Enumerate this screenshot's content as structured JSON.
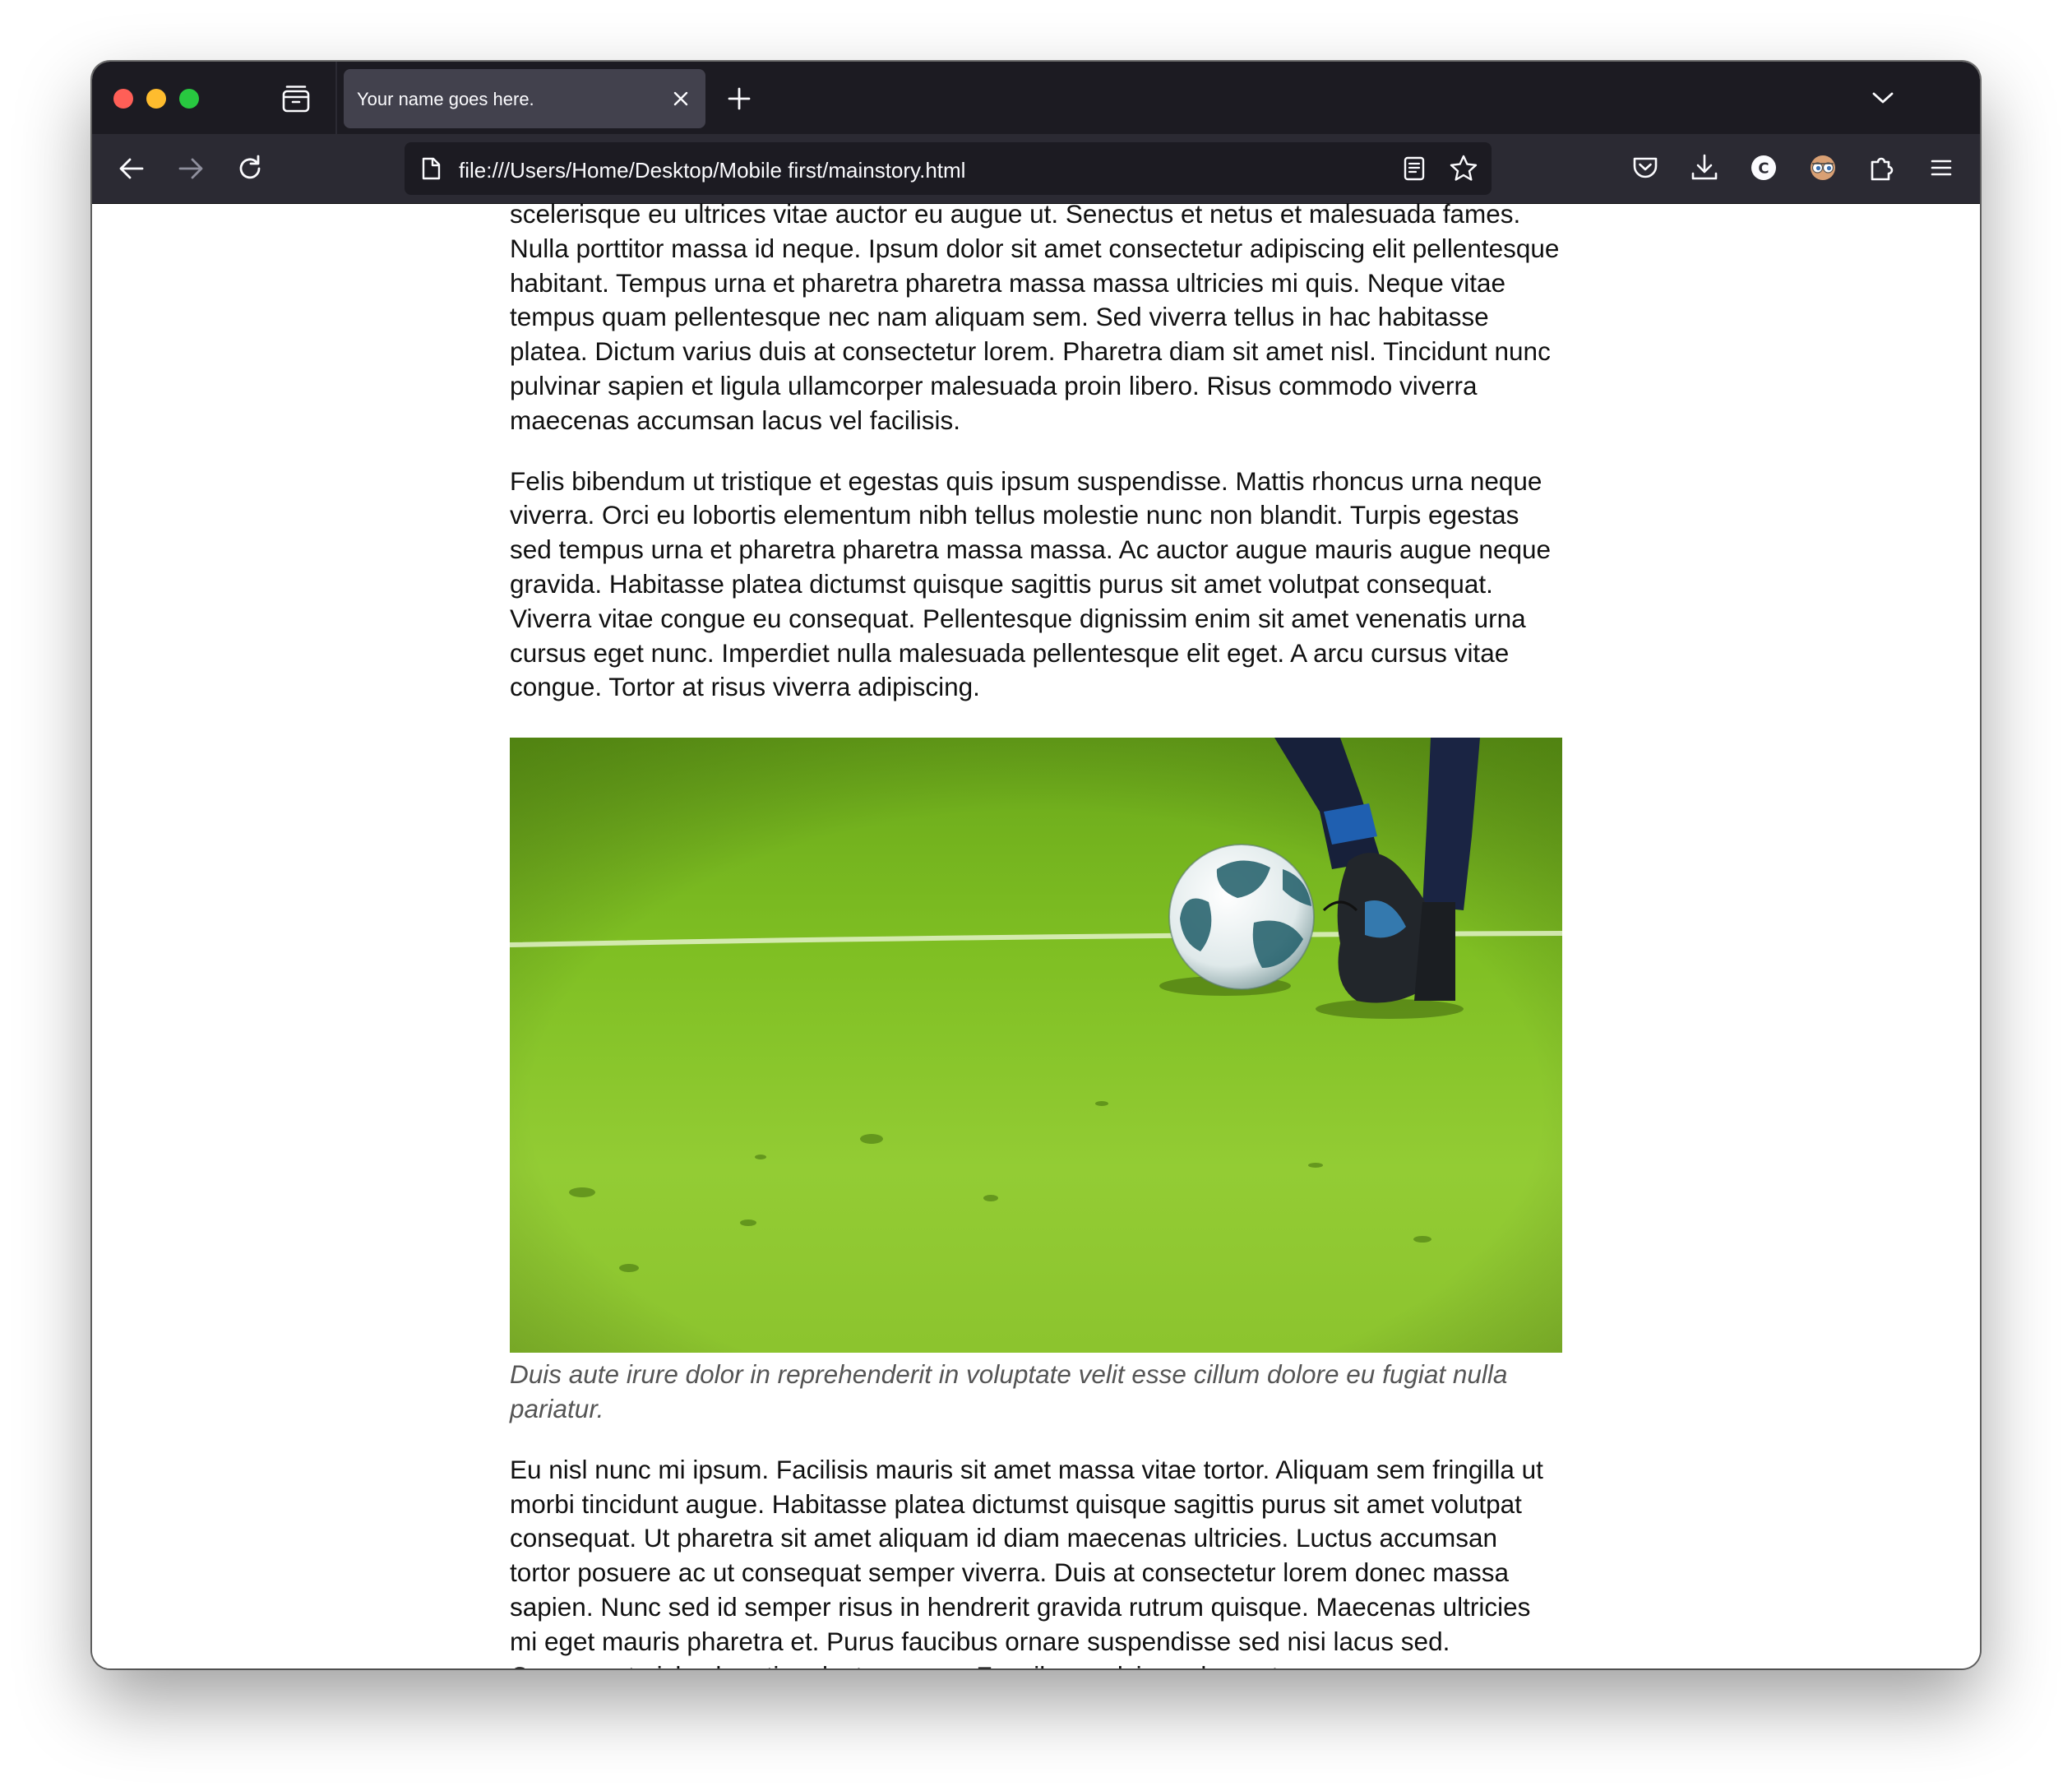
{
  "browser": {
    "tab_title": "Your name goes here.",
    "url": "file:///Users/Home/Desktop/Mobile first/mainstory.html",
    "icons": {
      "tab_overview": "tabs-overview-icon",
      "close": "close-icon",
      "new_tab": "plus-icon",
      "tab_list": "chevron-down-icon",
      "back": "back-arrow-icon",
      "forward": "forward-arrow-icon",
      "reload": "reload-icon",
      "page": "page-icon",
      "reader": "reader-view-icon",
      "bookmark": "star-icon",
      "pocket": "pocket-icon",
      "downloads": "download-icon",
      "extension_c": "c-extension-icon",
      "extension_eyes": "eyes-extension-icon",
      "extensions": "puzzle-icon",
      "menu": "hamburger-menu-icon"
    },
    "colors": {
      "tabstrip": "#1c1b22",
      "toolbar": "#2b2a33",
      "active_tab": "#42414d",
      "urlbar": "#1c1b22"
    }
  },
  "article": {
    "paragraph1": "scelerisque eu ultrices vitae auctor eu augue ut. Senectus et netus et malesuada fames. Nulla porttitor massa id neque. Ipsum dolor sit amet consectetur adipiscing elit pellentesque habitant. Tempus urna et pharetra pharetra massa massa ultricies mi quis. Neque vitae tempus quam pellentesque nec nam aliquam sem. Sed viverra tellus in hac habitasse platea. Dictum varius duis at consectetur lorem. Pharetra diam sit amet nisl. Tincidunt nunc pulvinar sapien et ligula ullamcorper malesuada proin libero. Risus commodo viverra maecenas accumsan lacus vel facilisis.",
    "paragraph2": "Felis bibendum ut tristique et egestas quis ipsum suspendisse. Mattis rhoncus urna neque viverra. Orci eu lobortis elementum nibh tellus molestie nunc non blandit. Turpis egestas sed tempus urna et pharetra pharetra massa massa. Ac auctor augue mauris augue neque gravida. Habitasse platea dictumst quisque sagittis purus sit amet volutpat consequat. Viverra vitae congue eu consequat. Pellentesque dignissim enim sit amet venenatis urna cursus eget nunc. Imperdiet nulla malesuada pellentesque elit eget. A arcu cursus vitae congue. Tortor at risus viverra adipiscing.",
    "image_caption": "Duis aute irure dolor in reprehenderit in voluptate velit esse cillum dolore eu fugiat nulla pariatur.",
    "paragraph3": "Eu nisl nunc mi ipsum. Facilisis mauris sit amet massa vitae tortor. Aliquam sem fringilla ut morbi tincidunt augue. Habitasse platea dictumst quisque sagittis purus sit amet volutpat consequat. Ut pharetra sit amet aliquam id diam maecenas ultricies. Luctus accumsan tortor posuere ac ut consequat semper viverra. Duis at consectetur lorem donec massa sapien. Nunc sed id semper risus in hendrerit gravida rutrum quisque. Maecenas ultricies mi eget mauris pharetra et. Purus faucibus ornare suspendisse sed nisi lacus sed. Consequat nisl vel pretium lectus quam. Faucibus pulvinar elementum"
  }
}
